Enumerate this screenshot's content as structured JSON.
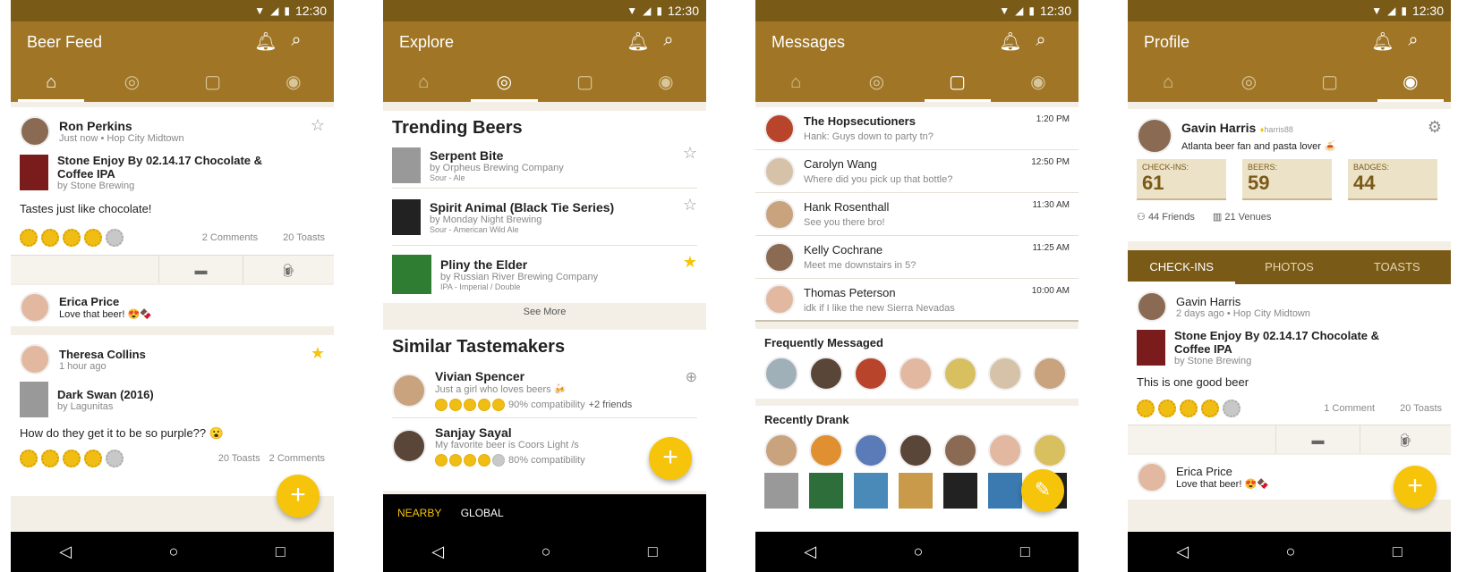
{
  "status": {
    "time": "12:30"
  },
  "icons": {
    "bell": "bell-icon",
    "search": "search-icon",
    "home": "home-icon",
    "compass": "compass-icon",
    "chat": "chat-icon",
    "profile": "profile-icon",
    "back": "back-icon",
    "home_nav": "home-circle-icon",
    "recent": "recent-icon"
  },
  "colors": {
    "header": "#a07626",
    "status": "#7a5a17",
    "accent": "#f6c40a"
  },
  "feed": {
    "title": "Beer Feed",
    "post1": {
      "user": "Ron Perkins",
      "time": "Just now",
      "location": "Hop City Midtown",
      "beer": "Stone Enjoy By 02.14.17 Chocolate & Coffee IPA",
      "brewery": "by Stone Brewing",
      "comment": "Tastes just like chocolate!",
      "rating": 4,
      "comments": "2 Comments",
      "toasts": "20 Toasts"
    },
    "reply": {
      "user": "Erica Price",
      "text": "Love that beer! 😍🍫"
    },
    "post2": {
      "user": "Theresa Collins",
      "time": "1 hour ago",
      "beer": "Dark Swan (2016)",
      "brewery": "by Lagunitas",
      "comment": "How do they get it to be so purple?? 😮",
      "rating": 4,
      "toasts": "20 Toasts",
      "comments": "2 Comments"
    }
  },
  "explore": {
    "title": "Explore",
    "trending_title": "Trending Beers",
    "beers": [
      {
        "name": "Serpent Bite",
        "brewery": "by Orpheus Brewing Company",
        "style": "Sour - Ale",
        "starred": false
      },
      {
        "name": "Spirit Animal (Black Tie Series)",
        "brewery": "by Monday Night Brewing",
        "style": "Sour - American Wild Ale",
        "starred": false
      },
      {
        "name": "Pliny the Elder",
        "brewery": "by Russian River Brewing Company",
        "style": "IPA - Imperial / Double",
        "starred": true
      }
    ],
    "see_more": "See More",
    "tastemakers_title": "Similar Tastemakers",
    "tastemakers": [
      {
        "name": "Vivian Spencer",
        "bio": "Just a girl who loves beers 🍻",
        "compat": "90% compatibility",
        "friends": "+2 friends"
      },
      {
        "name": "Sanjay Sayal",
        "bio": "My favorite beer is Coors Light /s",
        "compat": "80% compatibility",
        "friends": ""
      }
    ],
    "filter_nearby": "NEARBY",
    "filter_global": "GLOBAL"
  },
  "messages": {
    "title": "Messages",
    "threads": [
      {
        "name": "The Hopsecutioners",
        "preview": "Hank: Guys down to party tn?",
        "time": "1:20 PM"
      },
      {
        "name": "Carolyn Wang",
        "preview": "Where did you pick up that bottle?",
        "time": "12:50 PM"
      },
      {
        "name": "Hank Rosenthall",
        "preview": "See you there bro!",
        "time": "11:30 AM"
      },
      {
        "name": "Kelly Cochrane",
        "preview": "Meet me downstairs in 5?",
        "time": "11:25 AM"
      },
      {
        "name": "Thomas Peterson",
        "preview": "idk if I like the new Sierra Nevadas",
        "time": "10:00 AM"
      }
    ],
    "frequent_title": "Frequently Messaged",
    "recent_title": "Recently Drank"
  },
  "profile": {
    "title": "Profile",
    "name": "Gavin Harris",
    "handle": "harris88",
    "bio": "Atlanta beer fan and pasta lover 🍝",
    "checkins_label": "CHECK-INS:",
    "checkins": "61",
    "beers_label": "BEERS:",
    "beers": "59",
    "badges_label": "BADGES:",
    "badges": "44",
    "friends": "44 Friends",
    "venues": "21 Venues",
    "tabs": [
      "CHECK-INS",
      "PHOTOS",
      "TOASTS"
    ],
    "post": {
      "user": "Gavin Harris",
      "time": "2 days ago",
      "location": "Hop City Midtown",
      "beer": "Stone Enjoy By 02.14.17 Chocolate & Coffee IPA",
      "brewery": "by Stone Brewing",
      "comment": "This is one good beer",
      "rating": 4,
      "comments": "1 Comment",
      "toasts": "20 Toasts"
    },
    "reply": {
      "user": "Erica Price",
      "text": "Love that beer! 😍🍫"
    }
  }
}
